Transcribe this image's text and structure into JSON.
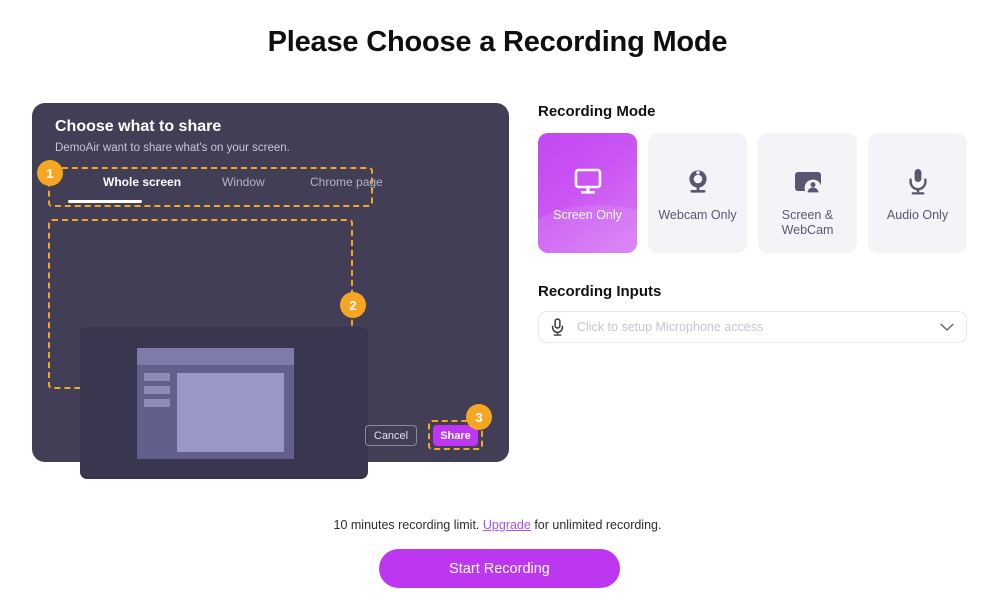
{
  "page": {
    "title": "Please Choose a Recording Mode"
  },
  "share_panel": {
    "title": "Choose what to share",
    "subtitle": "DemoAir want to share what's on your screen.",
    "tabs": [
      {
        "label": "Whole screen",
        "active": true
      },
      {
        "label": "Window",
        "active": false
      },
      {
        "label": "Chrome page",
        "active": false
      }
    ],
    "preview": {
      "icon": "screen-preview-illustration"
    },
    "cancel_label": "Cancel",
    "share_label": "Share",
    "badges": [
      {
        "number": "1",
        "target": "tabs"
      },
      {
        "number": "2",
        "target": "screen-preview"
      },
      {
        "number": "3",
        "target": "share-button"
      }
    ]
  },
  "recording_mode": {
    "label": "Recording Mode",
    "cards": [
      {
        "label": "Screen Only",
        "icon": "monitor-icon",
        "active": true
      },
      {
        "label": "Webcam Only",
        "icon": "webcam-icon",
        "active": false
      },
      {
        "label": "Screen & WebCam",
        "icon": "screen-webcam-icon",
        "active": false
      },
      {
        "label": "Audio Only",
        "icon": "microphone-icon",
        "active": false
      }
    ]
  },
  "recording_inputs": {
    "label": "Recording Inputs",
    "microphone_select": {
      "icon": "microphone-icon",
      "value": "",
      "placeholder": "Click to setup Microphone access",
      "chevron": "chevron-down-icon"
    }
  },
  "footer": {
    "limit_prefix": "10 minutes recording limit. ",
    "upgrade_link": "Upgrade",
    "limit_suffix": " for unlimited recording.",
    "start_label": "Start Recording"
  },
  "colors": {
    "accent_purple": "#bd37f0",
    "panel_dark": "#413e55",
    "badge_orange": "#f5a623",
    "card_inactive": "#f4f3f8",
    "card_icon": "#5a5671",
    "link_purple": "#a855e8"
  }
}
